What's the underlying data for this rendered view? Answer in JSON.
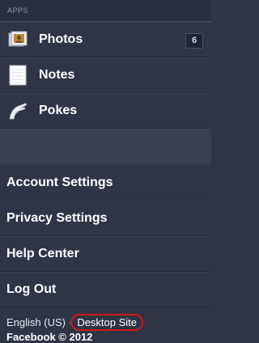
{
  "apps": {
    "header": "APPS",
    "items": [
      {
        "label": "Photos",
        "icon": "photos-icon",
        "count": "6"
      },
      {
        "label": "Notes",
        "icon": "notes-icon"
      },
      {
        "label": "Pokes",
        "icon": "pokes-icon"
      }
    ]
  },
  "settings": {
    "items": [
      {
        "label": "Account Settings"
      },
      {
        "label": "Privacy Settings"
      },
      {
        "label": "Help Center"
      },
      {
        "label": "Log Out"
      }
    ]
  },
  "footer": {
    "language": "English (US)",
    "separator": "·",
    "desktop_link": "Desktop Site",
    "copyright": "Facebook © 2012"
  },
  "colors": {
    "background": "#2f3545",
    "highlight_circle": "#d5151a"
  }
}
